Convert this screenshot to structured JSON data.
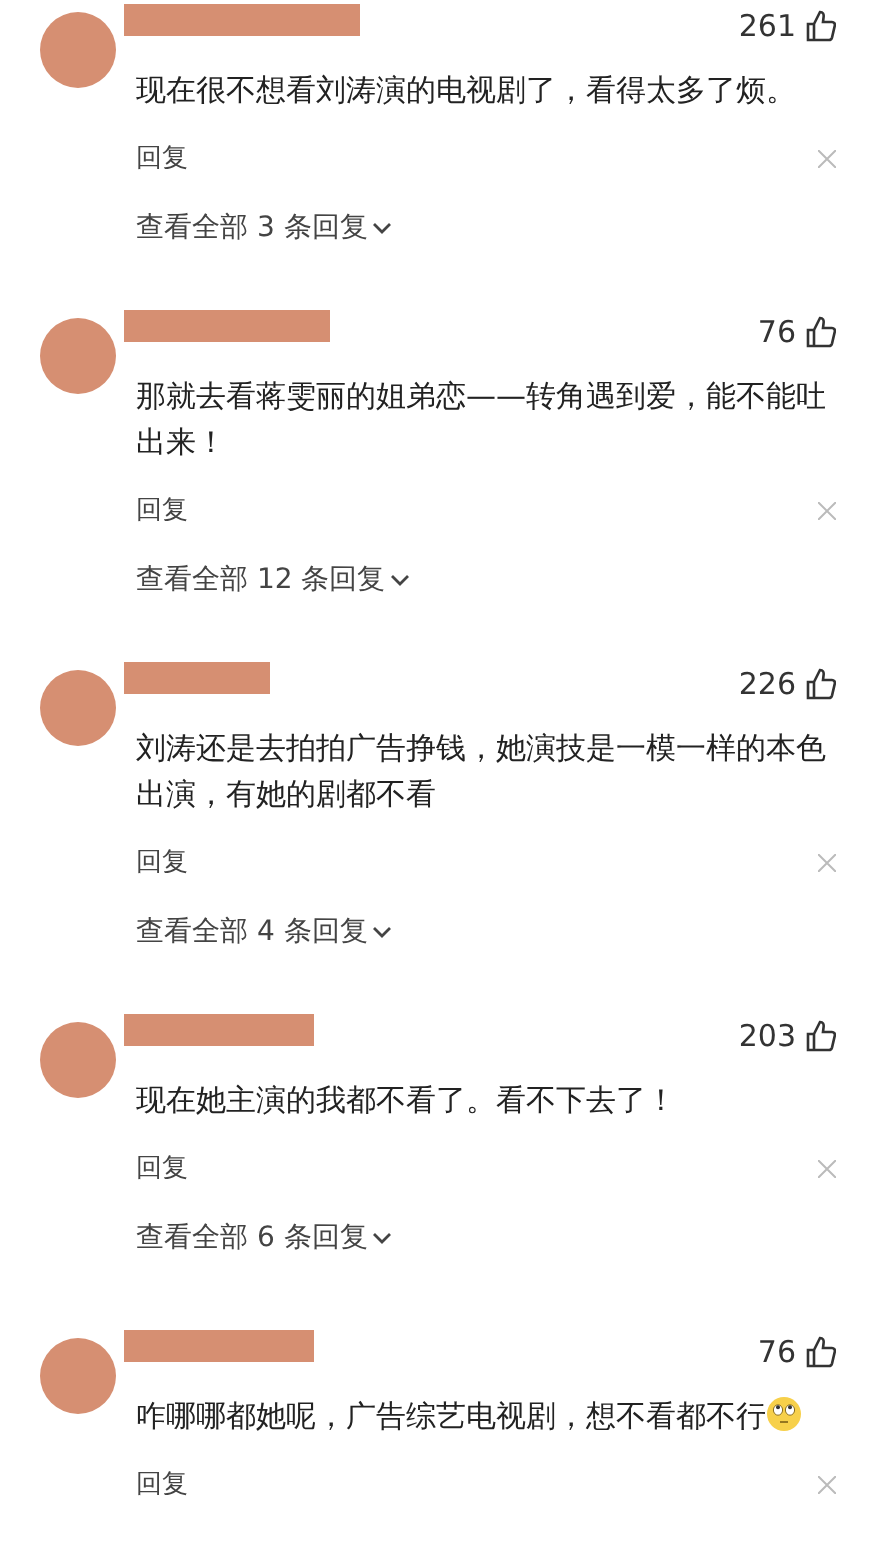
{
  "comments": [
    {
      "likes": "261",
      "text": "现在很不想看刘涛演的电视剧了，看得太多了烦。",
      "reply_label": "回复",
      "view_replies": "查看全部 3 条回复"
    },
    {
      "likes": "76",
      "text": "那就去看蒋雯丽的姐弟恋——转角遇到爱，能不能吐出来！",
      "reply_label": "回复",
      "view_replies": "查看全部 12 条回复"
    },
    {
      "likes": "226",
      "text": "刘涛还是去拍拍广告挣钱，她演技是一模一样的本色出演，有她的剧都不看",
      "reply_label": "回复",
      "view_replies": "查看全部 4 条回复"
    },
    {
      "likes": "203",
      "text": "现在她主演的我都不看了。看不下去了！",
      "reply_label": "回复",
      "view_replies": "查看全部 6 条回复"
    },
    {
      "likes": "76",
      "text": "咋哪哪都她呢，广告综艺电视剧，想不看都不行",
      "emoji": true,
      "reply_label": "回复"
    }
  ]
}
